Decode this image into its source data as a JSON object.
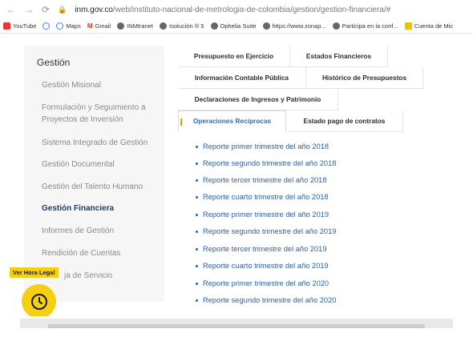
{
  "browser": {
    "url_host": "inm.gov.co",
    "url_path": "/web/instituto-nacional-de-metrologia-de-colombia/gestion/gestion-financiera/#",
    "bookmarks": [
      {
        "label": "YouTube",
        "icon": "youtube-icon"
      },
      {
        "label": "Google",
        "icon": "google-icon"
      },
      {
        "label": "Maps",
        "icon": "maps-icon"
      },
      {
        "label": "Gmail",
        "icon": "gmail-icon"
      },
      {
        "label": "INMtranet",
        "icon": "globe-icon"
      },
      {
        "label": "Isolución ® 5",
        "icon": "globe-icon"
      },
      {
        "label": "Ophelia Suite",
        "icon": "globe-icon"
      },
      {
        "label": "https://www.zonap...",
        "icon": "globe-icon"
      },
      {
        "label": "Participa en la conf...",
        "icon": "globe-icon"
      },
      {
        "label": "Cuenta de Mic",
        "icon": "bookmark-icon"
      }
    ]
  },
  "sidebar": {
    "title": "Gestión",
    "items": [
      {
        "label": "Gestión Misional",
        "active": false
      },
      {
        "label": "Formulación y Seguimiento a Proyectos de Inversión",
        "active": false
      },
      {
        "label": "Sistema Integrado de Gestión",
        "active": false
      },
      {
        "label": "Gestión Documental",
        "active": false
      },
      {
        "label": "Gestión del Talento Humano",
        "active": false
      },
      {
        "label": "Gestión Financiera",
        "active": true
      },
      {
        "label": "Informes de Gestión",
        "active": false
      },
      {
        "label": "Rendición de Cuentas",
        "active": false
      },
      {
        "label": "ja de Servicio",
        "active": false
      }
    ]
  },
  "tabs": [
    {
      "label": "Presupuesto en Ejercicio",
      "active": false
    },
    {
      "label": "Estados Financieros",
      "active": false
    },
    {
      "label": "Información Contable Pública",
      "active": false
    },
    {
      "label": "Histórico de Presupuestos",
      "active": false
    },
    {
      "label": "Declaraciones de Ingresos y Patrimonio",
      "active": false
    },
    {
      "label": "Operaciones Reciprocas",
      "active": true
    },
    {
      "label": "Estado pago de contratos",
      "active": false
    }
  ],
  "reports": [
    "Reporte primer trimestre del año 2018",
    "Reporte segundo trimestre del año 2018",
    "Reporte tercer trimestre del año 2018",
    "Reporte cuarto trimestre del año 2018",
    "Reporte primer trimestre del año 2019",
    "Reporte segundo trimestre del año 2019",
    "Reporte tercer trimestre del año 2019",
    "Reporte cuarto trimestre del año 2019",
    "Reporte primer trimestre del año 2020",
    "Reporte segundo trimestre del año 2020"
  ],
  "legal_time": {
    "label": "Ver Hora Legal",
    "icon": "clock-icon"
  },
  "colors": {
    "accent": "#f5cf12",
    "link": "#2a5fa3",
    "active_sidebar": "#1d3b5e"
  }
}
